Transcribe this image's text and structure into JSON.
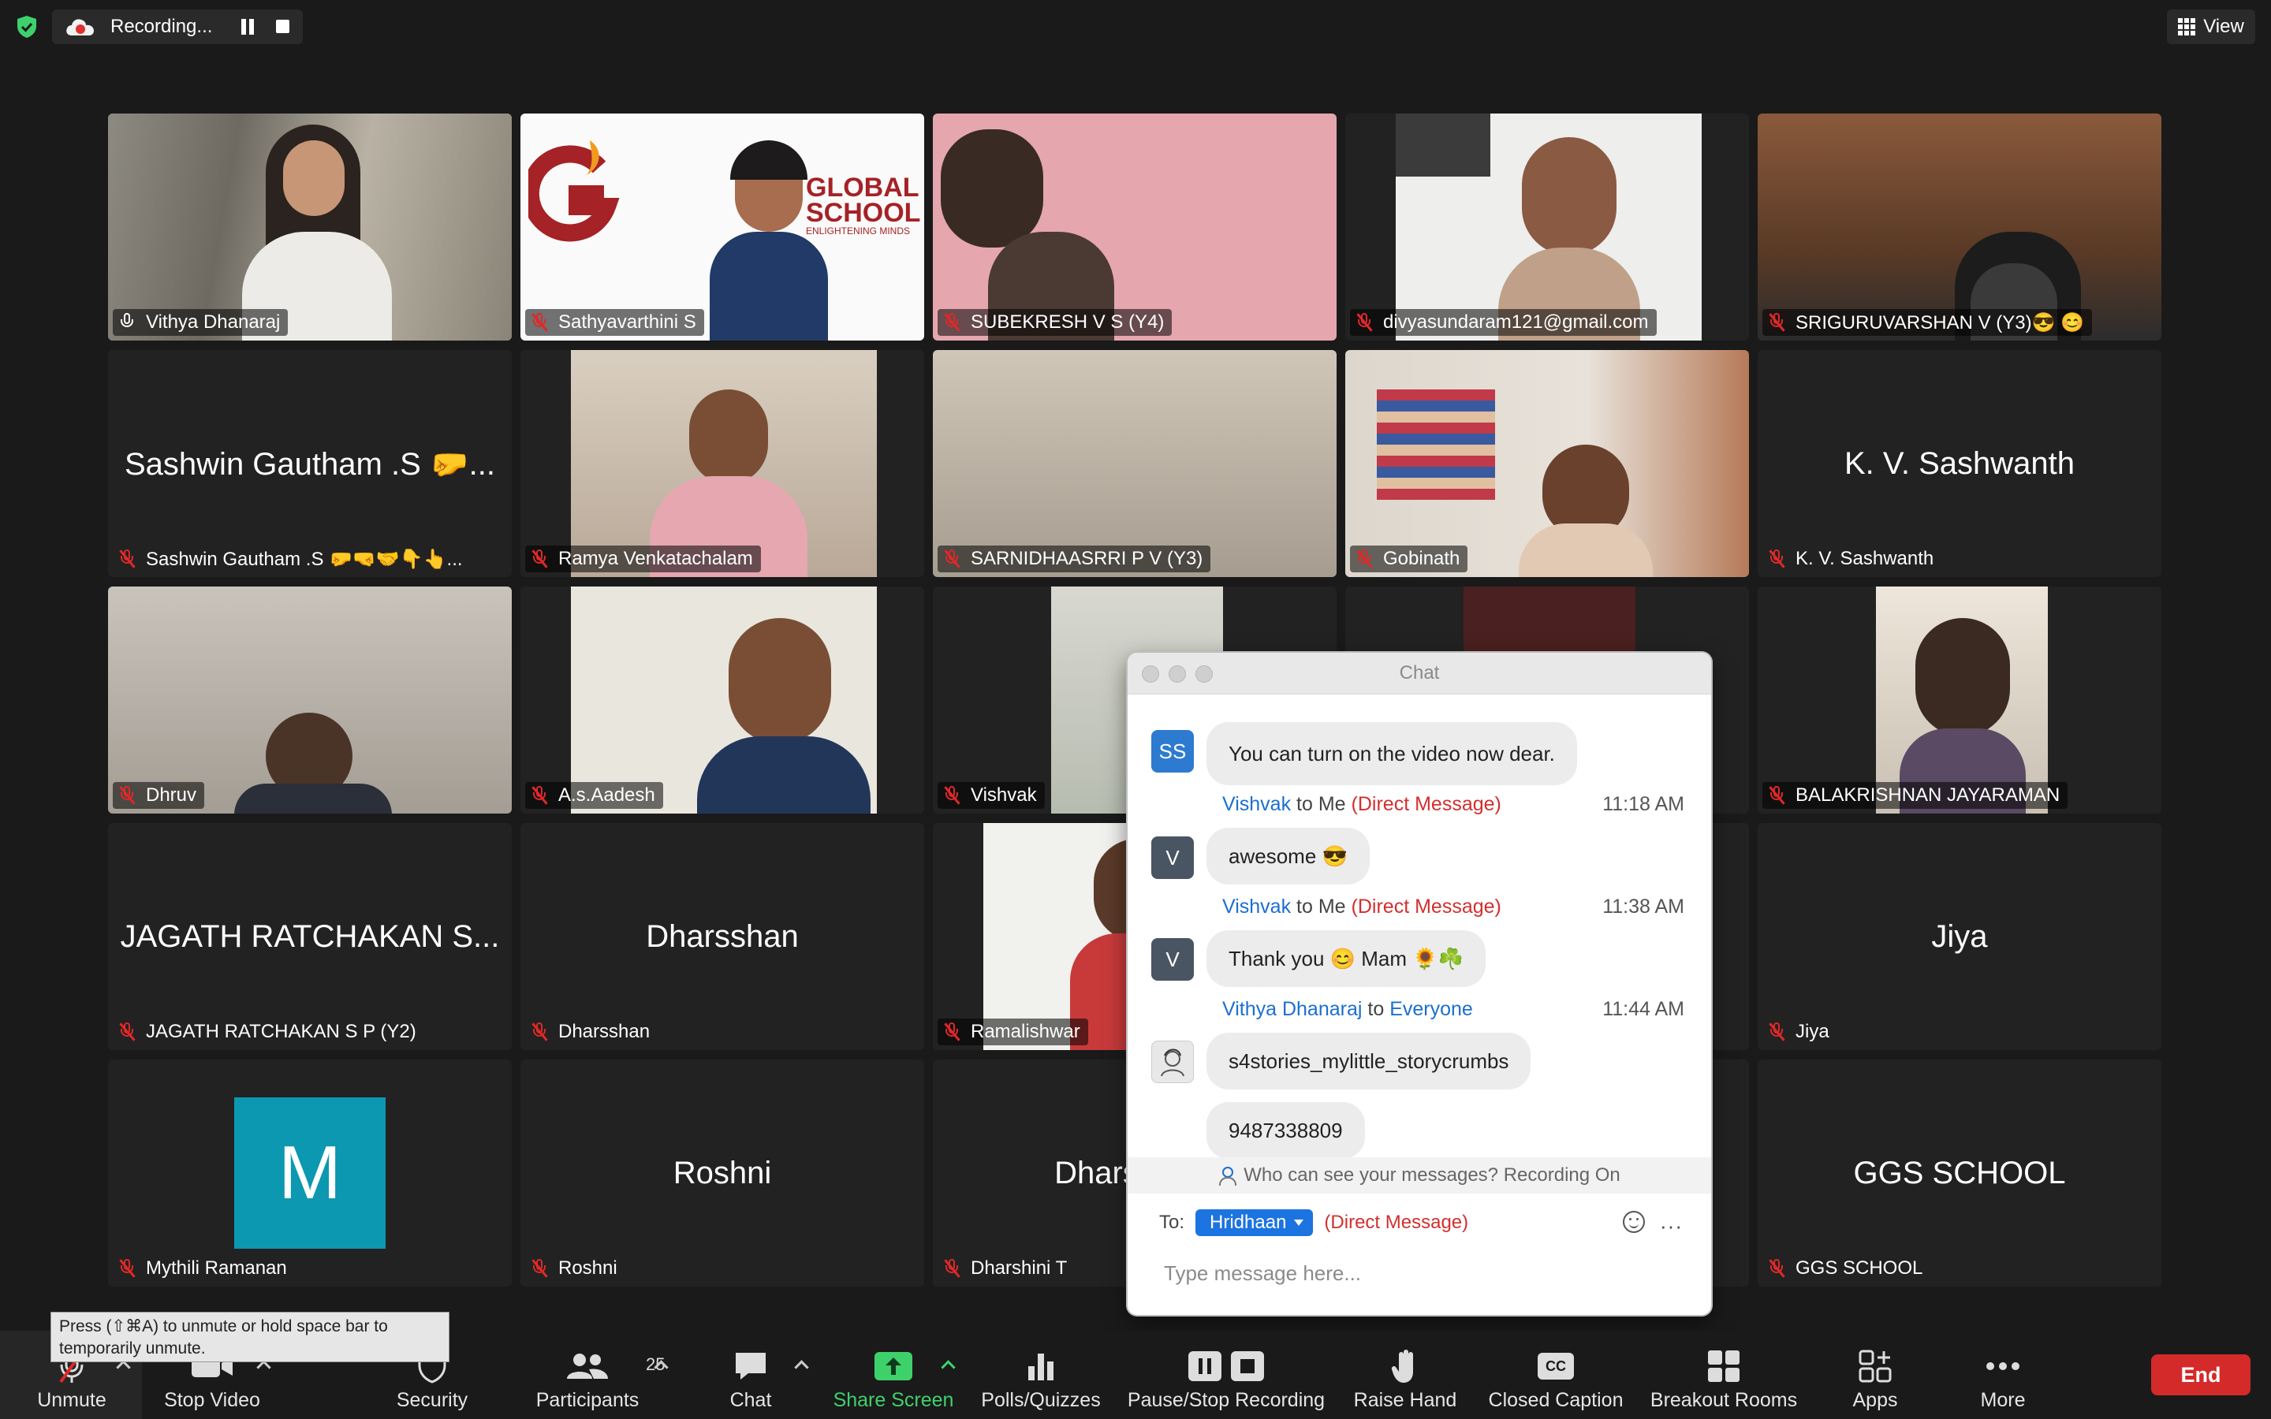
{
  "topbar": {
    "recording_label": "Recording...",
    "view_label": "View"
  },
  "tiles": [
    {
      "label": "Vithya Dhanaraj"
    },
    {
      "label": "Sathyavarthini S"
    },
    {
      "label": "SUBEKRESH V S (Y4)"
    },
    {
      "label": "divyasundaram121@gmail.com"
    },
    {
      "label": "SRIGURUVARSHAN V (Y3)😎 😊"
    },
    {
      "label": "Sashwin Gautham .S 🤛🤜🤝👇👆...",
      "big": "Sashwin Gautham .S 🤛..."
    },
    {
      "label": "Ramya Venkatachalam"
    },
    {
      "label": "SARNIDHAASRRI P V (Y3)"
    },
    {
      "label": "Gobinath"
    },
    {
      "label": "K. V. Sashwanth",
      "big": "K. V. Sashwanth"
    },
    {
      "label": "Dhruv"
    },
    {
      "label": "A.s.Aadesh"
    },
    {
      "label": "Vishvak"
    },
    {
      "label": "BALAKRISHNAN JAYARAMAN"
    },
    {
      "label": "JAGATH RATCHAKAN S P (Y2)",
      "big": "JAGATH RATCHAKAN S..."
    },
    {
      "label": "Dharsshan",
      "big": "Dharsshan"
    },
    {
      "label": "Ramalishwar"
    },
    {
      "label": "Jiya",
      "big": "Jiya"
    },
    {
      "label": "Mythili Ramanan",
      "avatar_letter": "M"
    },
    {
      "label": "Roshni",
      "big": "Roshni"
    },
    {
      "label": "Dharshini T",
      "big": "Dharshini T"
    },
    {
      "label": "GGS SCHOOL",
      "big": "GGS SCHOOL"
    }
  ],
  "logo": {
    "school_line1": "GLOBAL",
    "school_line2": "SCHOOL",
    "tagline": "ENLIGHTENING MINDS"
  },
  "chat": {
    "title": "Chat",
    "messages": [
      {
        "avatar": "SS",
        "text": "You can turn on the video now dear."
      },
      {
        "from": "Vishvak",
        "to_word": "to",
        "to": "Me",
        "dm": "(Direct Message)",
        "time": "11:18 AM",
        "avatar": "V",
        "text": "awesome 😎"
      },
      {
        "from": "Vishvak",
        "to_word": "to",
        "to": "Me",
        "dm": "(Direct Message)",
        "time": "11:38 AM",
        "avatar": "V",
        "text": "Thank you 😊 Mam 🌻☘️"
      },
      {
        "from": "Vithya Dhanaraj",
        "to_word": "to",
        "to": "Everyone",
        "time": "11:44 AM",
        "text": "s4stories_mylittle_storycrumbs"
      },
      {
        "text": "9487338809"
      }
    ],
    "visibility_notice": "Who can see your messages? Recording On",
    "to_label": "To:",
    "recipient": "Hridhaan",
    "recipient_mode": "(Direct Message)",
    "input_placeholder": "Type message here...",
    "more": "···"
  },
  "toolbar": {
    "unmute": "Unmute",
    "stop_video": "Stop Video",
    "security": "Security",
    "participants": "Participants",
    "participants_count": "25",
    "chat": "Chat",
    "share_screen": "Share Screen",
    "polls": "Polls/Quizzes",
    "pause_stop_recording": "Pause/Stop Recording",
    "raise_hand": "Raise Hand",
    "closed_caption": "Closed Caption",
    "cc_badge": "CC",
    "breakout_rooms": "Breakout Rooms",
    "apps": "Apps",
    "more": "More",
    "end": "End"
  },
  "tooltip": {
    "text": "Press  (⇧⌘A) to unmute or hold space bar to temporarily unmute."
  },
  "colors": {
    "accent_green": "#3ed16b",
    "end_red": "#d42a2a",
    "chip_blue": "#1c74e0",
    "dm_red": "#d32f2f",
    "name_blue": "#1a6fd1",
    "avatar_teal": "#0c98b0"
  }
}
